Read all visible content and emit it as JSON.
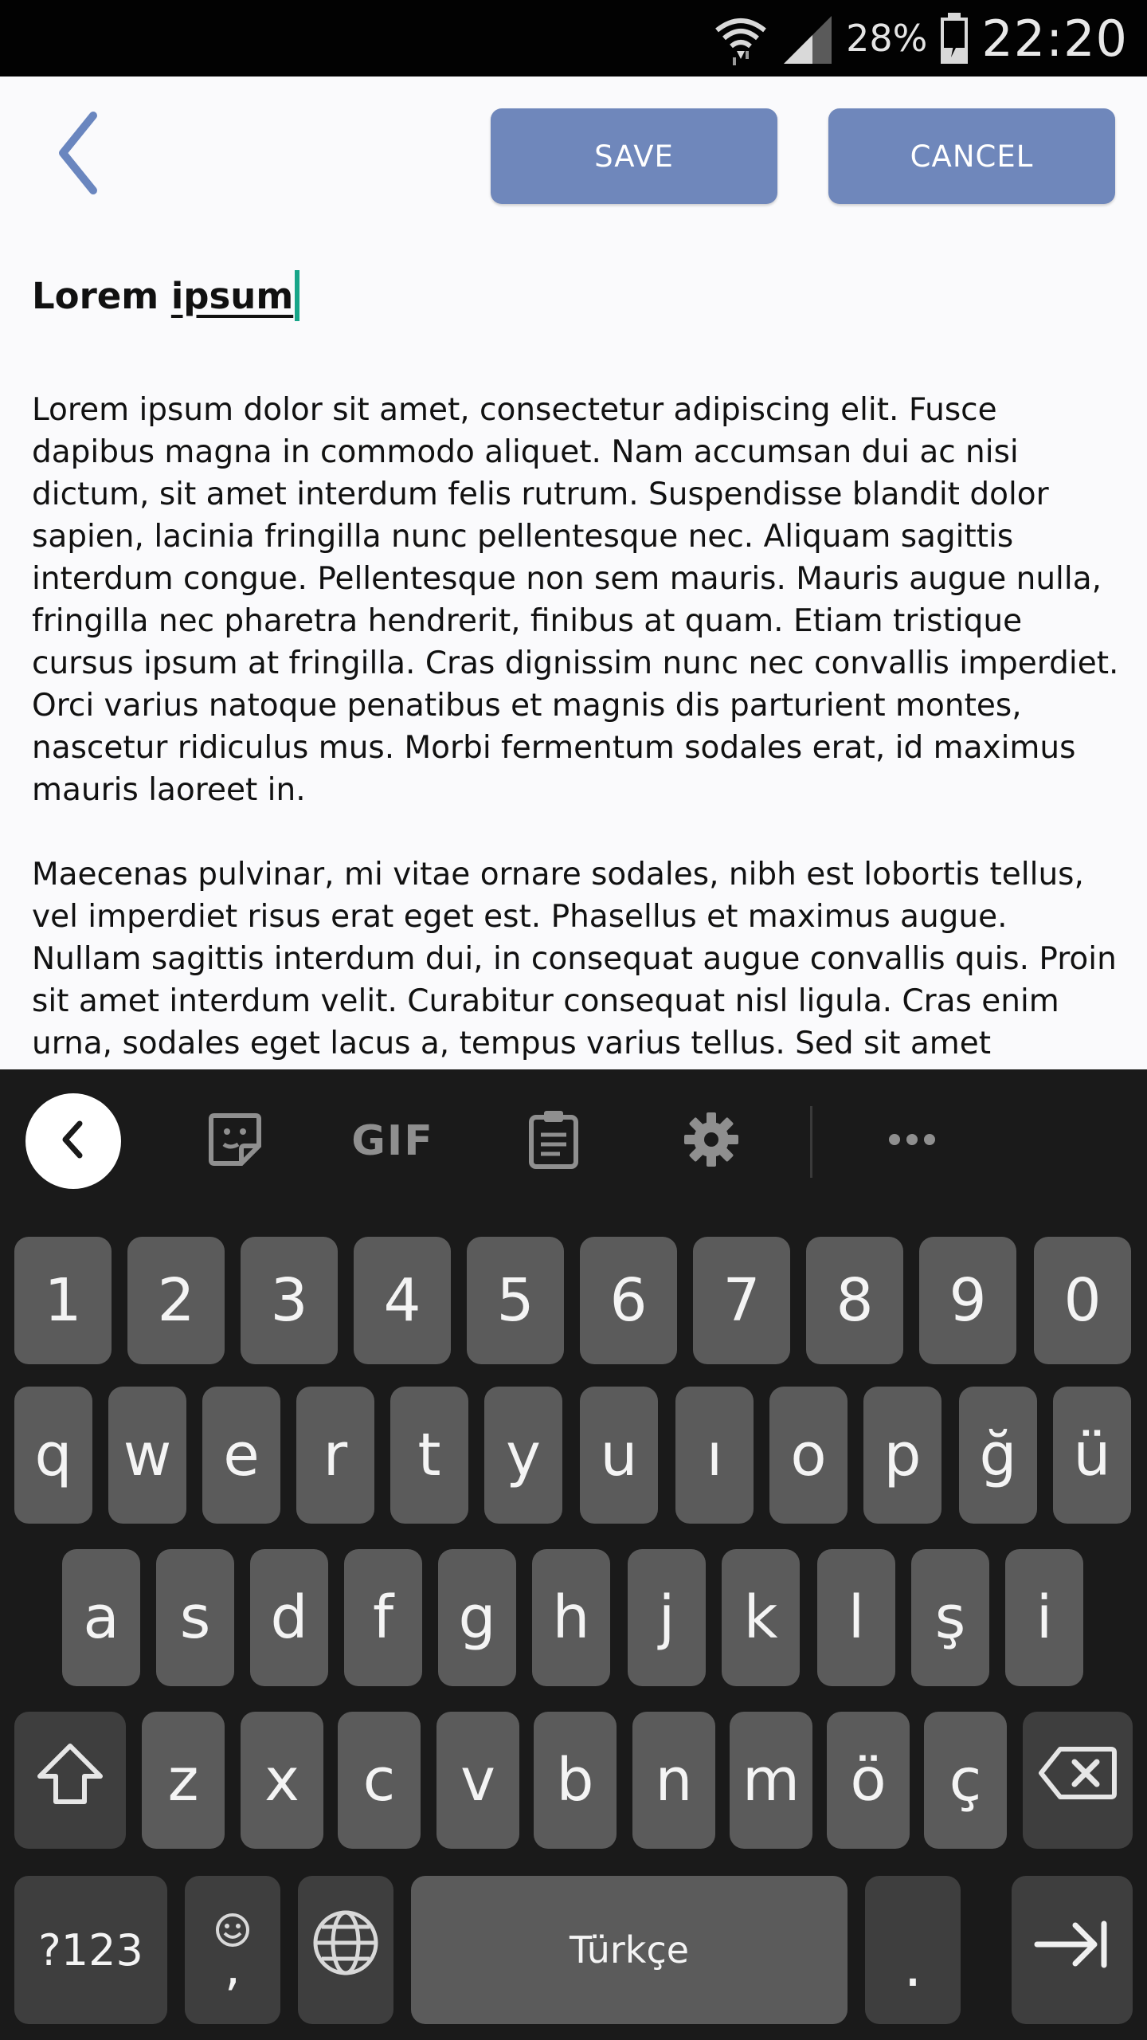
{
  "status_bar": {
    "battery_percent": "28%",
    "time": "22:20",
    "icons": [
      "wifi-icon",
      "signal-icon",
      "battery-charging-icon"
    ]
  },
  "toolbar": {
    "back_icon": "chevron-left-icon",
    "save_label": "SAVE",
    "cancel_label": "CANCEL",
    "accent_color": "#6f87bb"
  },
  "note": {
    "title_part1": "Lorem ",
    "title_part2": "ipsum",
    "paragraphs": [
      "Lorem ipsum dolor sit amet, consectetur adipiscing elit. Fusce dapibus magna in commodo aliquet. Nam accumsan dui ac nisi dictum, sit amet interdum felis rutrum. Suspendisse blandit dolor sapien, lacinia fringilla nunc pellentesque nec. Aliquam sagittis interdum congue. Pellentesque non sem mauris. Mauris augue nulla, fringilla nec pharetra hendrerit, finibus at quam. Etiam tristique cursus ipsum at fringilla. Cras dignissim nunc nec convallis imperdiet. Orci varius natoque penatibus et magnis dis parturient montes, nascetur ridiculus mus. Morbi fermentum sodales erat, id maximus mauris laoreet in.",
      "Maecenas pulvinar, mi vitae ornare sodales, nibh est lobortis tellus, vel imperdiet risus erat eget est. Phasellus et maximus augue. Nullam sagittis interdum dui, in consequat augue convallis quis. Proin sit amet interdum velit. Curabitur consequat nisl ligula. Cras enim urna, sodales eget lacus a, tempus varius tellus. Sed sit amet"
    ]
  },
  "keyboard": {
    "toolbar": {
      "gif_label": "GIF",
      "icons": [
        "chevron-left-icon",
        "sticker-icon",
        "gif-icon",
        "clipboard-icon",
        "gear-icon",
        "more-icon"
      ]
    },
    "rows": {
      "numbers": [
        "1",
        "2",
        "3",
        "4",
        "5",
        "6",
        "7",
        "8",
        "9",
        "0"
      ],
      "row1": [
        "q",
        "w",
        "e",
        "r",
        "t",
        "y",
        "u",
        "ı",
        "o",
        "p",
        "ğ",
        "ü"
      ],
      "row2": [
        "a",
        "s",
        "d",
        "f",
        "g",
        "h",
        "j",
        "k",
        "l",
        "ş",
        "i"
      ],
      "row3": [
        "z",
        "x",
        "c",
        "v",
        "b",
        "n",
        "m",
        "ö",
        "ç"
      ]
    },
    "bottom": {
      "symbols_label": "?123",
      "comma_label": ",",
      "space_label": "Türkçe",
      "period_label": ".",
      "icons": [
        "shift-icon",
        "backspace-icon",
        "emoji-icon",
        "globe-icon",
        "tab-arrow-icon"
      ]
    }
  }
}
